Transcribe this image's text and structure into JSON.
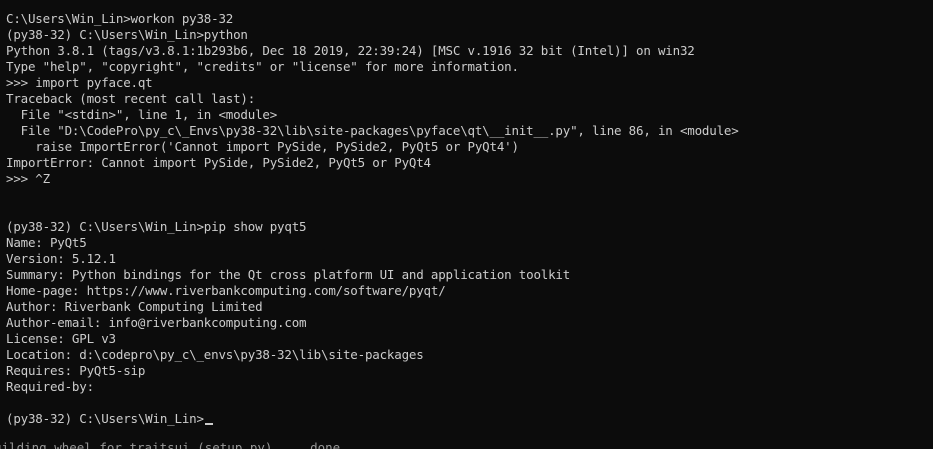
{
  "terminal": {
    "lines": [
      "C:\\Users\\Win_Lin>workon py38-32",
      "(py38-32) C:\\Users\\Win_Lin>python",
      "Python 3.8.1 (tags/v3.8.1:1b293b6, Dec 18 2019, 22:39:24) [MSC v.1916 32 bit (Intel)] on win32",
      "Type \"help\", \"copyright\", \"credits\" or \"license\" for more information.",
      ">>> import pyface.qt",
      "Traceback (most recent call last):",
      "  File \"<stdin>\", line 1, in <module>",
      "  File \"D:\\CodePro\\py_c\\_Envs\\py38-32\\lib\\site-packages\\pyface\\qt\\__init__.py\", line 86, in <module>",
      "    raise ImportError('Cannot import PySide, PySide2, PyQt5 or PyQt4')",
      "ImportError: Cannot import PySide, PySide2, PyQt5 or PyQt4",
      ">>> ^Z",
      "",
      "",
      "(py38-32) C:\\Users\\Win_Lin>pip show pyqt5",
      "Name: PyQt5",
      "Version: 5.12.1",
      "Summary: Python bindings for the Qt cross platform UI and application toolkit",
      "Home-page: https://www.riverbankcomputing.com/software/pyqt/",
      "Author: Riverbank Computing Limited",
      "Author-email: info@riverbankcomputing.com",
      "License: GPL v3",
      "Location: d:\\codepro\\py_c\\_envs\\py38-32\\lib\\site-packages",
      "Requires: PyQt5-sip",
      "Required-by:",
      "",
      "(py38-32) C:\\Users\\Win_Lin>"
    ],
    "below_fragment": "uilding wheel for traitsui (setup.py) ... done",
    "colors": {
      "background": "#0c0c0c",
      "foreground": "#cccccc"
    }
  }
}
